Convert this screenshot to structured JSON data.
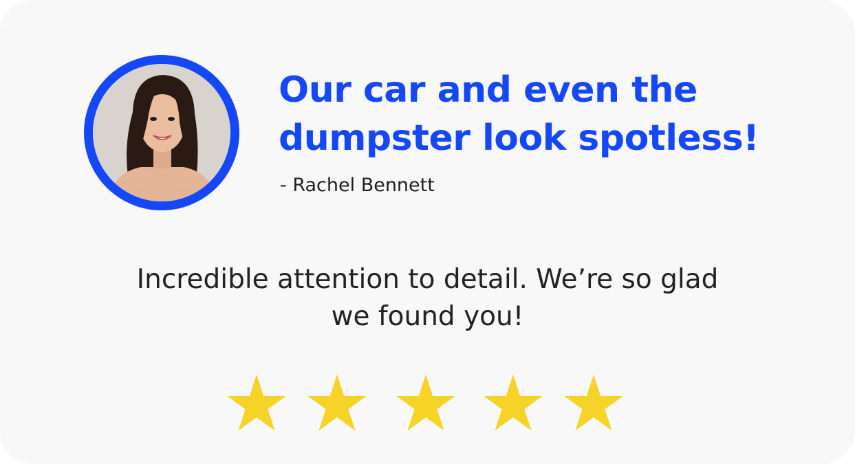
{
  "testimonial": {
    "headline_lines": [
      "Our car and even the",
      "dumpster look spotless!"
    ],
    "author": "- Rachel Bennett",
    "review_lines": [
      "Incredible attention to detail. We’re so glad",
      "we found you!"
    ],
    "avatar_icon": "customer-photo",
    "rating": {
      "value": 5,
      "max": 5,
      "icon": "star-icon"
    }
  },
  "colors": {
    "accent": "#1447f5",
    "star": "#f5d327",
    "card_background": "#f8f8f8",
    "text": "#222222"
  }
}
